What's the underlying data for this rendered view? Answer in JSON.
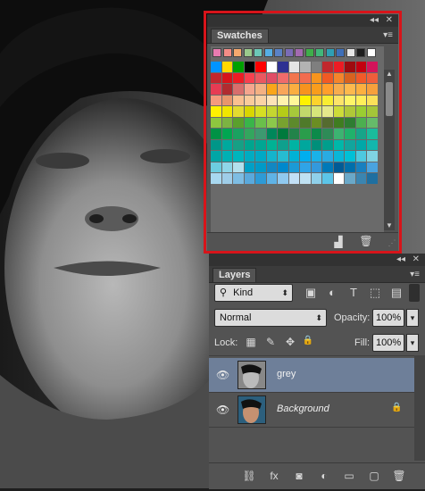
{
  "canvas": {
    "bg": "#2a2a2a"
  },
  "swatches_panel": {
    "tab": "Swatches",
    "controls": {
      "collapse": "◂◂",
      "close": "✕",
      "menu": "▾≡"
    },
    "recent": [
      "#e87bb0",
      "#f38c86",
      "#f5a86e",
      "#9ac98c",
      "#6cc7b7",
      "#56aee4",
      "#5a82c6",
      "#7a6cb6",
      "#a36ab0",
      "#3fae4a",
      "#42b77a",
      "#2f9fb4",
      "#3e6fb8",
      "#e7e7e7",
      "#1d1d1d",
      "#ffffff"
    ],
    "rows": [
      [
        "#0094ff",
        "#ffd800",
        "#00a000",
        "#000000",
        "#ff0000",
        "#ffffff",
        "#2e3192",
        "#e4e4e4",
        "#b3b3b3",
        "#7f7f7f",
        "#c1272d",
        "#ed1c24",
        "#9e0b0f",
        "#c30010",
        "#d4145a"
      ],
      [
        "#c1272d",
        "#d7141a",
        "#ed1c24",
        "#f7404f",
        "#ea5860",
        "#e14d66",
        "#ef6b6b",
        "#f2754d",
        "#f26c4f",
        "#f7941d",
        "#f15a24",
        "#f4852b",
        "#d8621f",
        "#f15a29",
        "#ef5e3b"
      ],
      [
        "#e73b53",
        "#b12b2f",
        "#d86e6c",
        "#f5a68e",
        "#f4b183",
        "#faa61a",
        "#f8a65a",
        "#fbae40",
        "#f7931e",
        "#f99d1c",
        "#ff9e2c",
        "#f7ad4e",
        "#fdb94e",
        "#fcb040",
        "#f7a03c"
      ],
      [
        "#f59a7d",
        "#e8966c",
        "#fac090",
        "#f9cb9c",
        "#fbd3a6",
        "#fde3b8",
        "#fff2ad",
        "#fff799",
        "#fef200",
        "#fdd32d",
        "#f9ed32",
        "#fde46a",
        "#fff568",
        "#ffef5a",
        "#fbe159"
      ],
      [
        "#fff100",
        "#f0e600",
        "#e3dc2f",
        "#d9d600",
        "#d7df23",
        "#c5d630",
        "#b5cc18",
        "#a6c93b",
        "#c2d96b",
        "#d7e57a",
        "#e5e98b",
        "#cddc39",
        "#afc838",
        "#9acd32",
        "#a4c639"
      ],
      [
        "#8dc63f",
        "#7cb342",
        "#5aa02c",
        "#39b54a",
        "#6abf4b",
        "#8cc84b",
        "#78a22f",
        "#5d8a2c",
        "#4f7a2a",
        "#6b8e23",
        "#556b2f",
        "#3f7d20",
        "#2e7d32",
        "#4caf50",
        "#66bb6a"
      ],
      [
        "#009245",
        "#00a651",
        "#1aa260",
        "#33a65e",
        "#3d9970",
        "#00875a",
        "#007a3d",
        "#22834a",
        "#2a9d4b",
        "#0c8a4a",
        "#2e8b57",
        "#3cb371",
        "#20b26b",
        "#17a589",
        "#1abc9c"
      ],
      [
        "#009688",
        "#00a99d",
        "#16a085",
        "#00a58e",
        "#00a693",
        "#00b294",
        "#0fa08d",
        "#00b3a3",
        "#00a79d",
        "#008f7a",
        "#009e8c",
        "#00b8a9",
        "#11a59d",
        "#00a8a8",
        "#13b6ad"
      ],
      [
        "#00a6a6",
        "#00b0b3",
        "#00b5bd",
        "#00acc1",
        "#00a9c5",
        "#14b4cc",
        "#26bcd1",
        "#00b2d6",
        "#00aeef",
        "#1ab2e8",
        "#29abe2",
        "#0ab6d8",
        "#00c0d6",
        "#4dc9df",
        "#7fd3e2"
      ],
      [
        "#6ccde0",
        "#8fd6e8",
        "#b3e0ed",
        "#00a0c6",
        "#009ac7",
        "#1287c2",
        "#0088cc",
        "#1b9ad6",
        "#2fa4e7",
        "#3399dd",
        "#0079b8",
        "#005b96",
        "#006fab",
        "#1980bf",
        "#4aa3df"
      ],
      [
        "#a8d8f0",
        "#9fcde8",
        "#7ebde3",
        "#5aa9dc",
        "#2e9bd6",
        "#5fb3e6",
        "#90c9ef",
        "#c2e0f6",
        "#bfe1f2",
        "#8fd0ea",
        "#5cc5e8",
        "#ffffff",
        "#6aa8c8",
        "#3b85b0",
        "#1f6fa0"
      ]
    ],
    "bottom": {
      "new": "new-swatch-icon",
      "trash": "trash-icon"
    }
  },
  "layers_panel": {
    "tab": "Layers",
    "controls": {
      "collapse": "◂◂",
      "close": "✕",
      "menu": "▾≡"
    },
    "filter": {
      "label": "Kind",
      "search_icon": "⚲"
    },
    "filter_icons": [
      "image-filter-icon",
      "adjustment-filter-icon",
      "type-filter-icon",
      "shape-filter-icon",
      "smart-object-filter-icon"
    ],
    "filter_icon_glyphs": [
      "▣",
      "◐",
      "T",
      "⬚",
      "▤"
    ],
    "blend": {
      "mode": "Normal",
      "opacity_label": "Opacity:",
      "opacity": "100%"
    },
    "lock": {
      "label": "Lock:",
      "fill_label": "Fill:",
      "fill": "100%",
      "glyphs": [
        "▦",
        "✎",
        "✥",
        "🔒"
      ]
    },
    "layers": [
      {
        "name": "grey",
        "selected": true,
        "locked": false
      },
      {
        "name": "Background",
        "selected": false,
        "locked": true
      }
    ],
    "bottom_glyphs": [
      "⛓",
      "fx",
      "◙",
      "◐",
      "▭",
      "▢",
      "🗑"
    ]
  }
}
